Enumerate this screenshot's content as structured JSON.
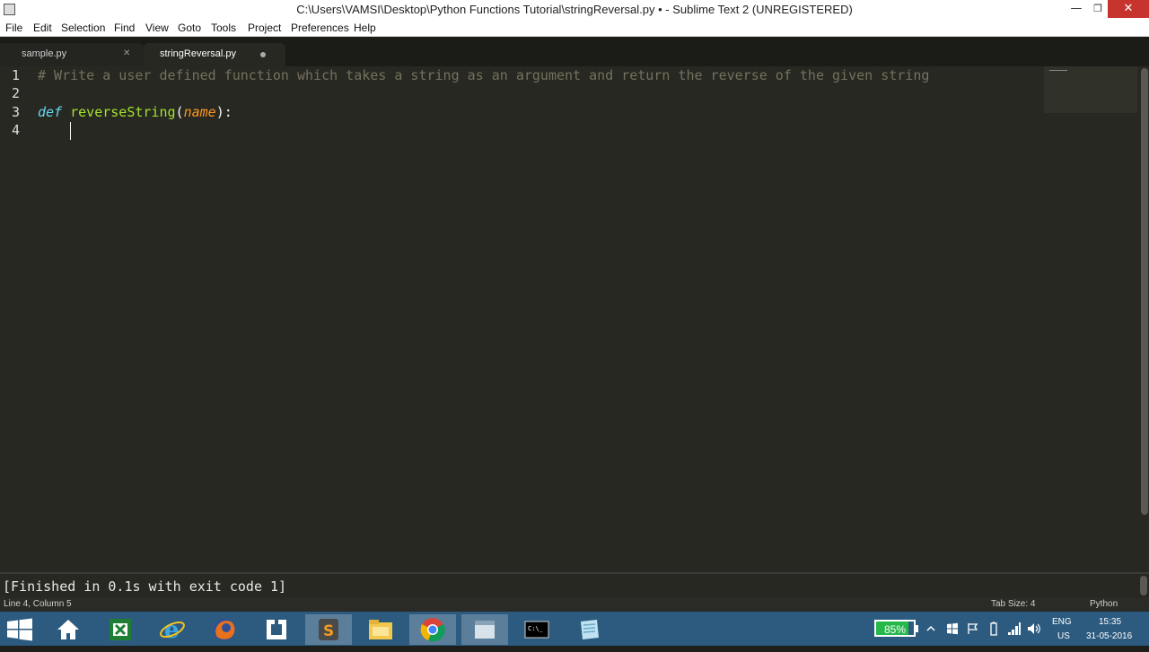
{
  "window": {
    "title": "C:\\Users\\VAMSI\\Desktop\\Python Functions Tutorial\\stringReversal.py • - Sublime Text 2 (UNREGISTERED)",
    "minimize": "—",
    "restore": "❐",
    "close": "✕"
  },
  "menu": [
    "File",
    "Edit",
    "Selection",
    "Find",
    "View",
    "Goto",
    "Tools",
    "Project",
    "Preferences",
    "Help"
  ],
  "tabs": [
    {
      "label": "sample.py",
      "close": "✕"
    },
    {
      "label": "stringReversal.py"
    }
  ],
  "editor": {
    "line_numbers": [
      "1",
      "2",
      "3",
      "4"
    ],
    "line1_comment": "# Write a user defined function which takes a string as an argument and return the reverse of the given string",
    "line3": {
      "keyword": "def",
      "fn_name": "reverseString",
      "open": "(",
      "param": "name",
      "close": "):"
    }
  },
  "output": "[Finished in 0.1s with exit code 1]",
  "status": {
    "position": "Line 4, Column 5",
    "tab_size": "Tab Size: 4",
    "syntax": "Python"
  },
  "taskbar": {
    "items": [
      {
        "name": "start",
        "icon": "windows-logo"
      },
      {
        "name": "home",
        "icon": "house"
      },
      {
        "name": "excel",
        "icon": "spreadsheet"
      },
      {
        "name": "internet-explorer",
        "icon": "e"
      },
      {
        "name": "firefox",
        "icon": "fox"
      },
      {
        "name": "app",
        "icon": "frame"
      },
      {
        "name": "sublime-text",
        "icon": "S"
      },
      {
        "name": "file-explorer",
        "icon": "folder"
      },
      {
        "name": "chrome",
        "icon": "chrome"
      },
      {
        "name": "window",
        "icon": "window"
      },
      {
        "name": "cmd",
        "icon": "C:\\_"
      },
      {
        "name": "notes",
        "icon": "note"
      }
    ],
    "battery_percent": "85%",
    "battery_level": 0.85,
    "language": "ENG",
    "region": "US",
    "time": "15:35",
    "date": "31-05-2016"
  }
}
